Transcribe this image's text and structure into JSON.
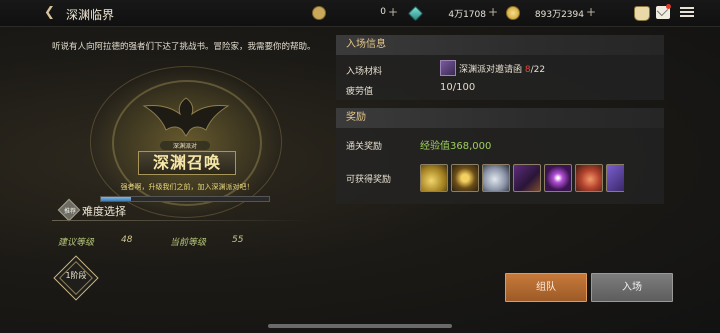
{
  "header": {
    "title": "深渊临界",
    "resources": [
      {
        "icon": "currency-icon",
        "value": "0"
      },
      {
        "icon": "gem-icon",
        "value": "4万1708"
      },
      {
        "icon": "gold-icon",
        "value": "893万2394"
      }
    ],
    "plus": "+"
  },
  "left": {
    "intro": "听说有人向阿拉德的强者们下达了挑战书。冒险家，我需要你的帮助。",
    "emblem": {
      "subtitle": "深渊派对",
      "title": "深渊召唤",
      "desc": "强者啊，升级我们之前，加入深渊派对吧！",
      "progress": 0.18
    },
    "difficulty": {
      "icon_text": "推荐",
      "label": "难度选择"
    },
    "levels": {
      "recommended_label": "建议等级",
      "recommended_value": "48",
      "current_label": "当前等级",
      "current_value": "55"
    },
    "stage_label": "1阶段"
  },
  "right": {
    "entry": {
      "header": "入场信息",
      "material_label": "入场材料",
      "material_name": "深渊派对邀请函",
      "material_count": "8",
      "material_total": "/22",
      "fatigue_label": "疲劳值",
      "fatigue_value": "10/100"
    },
    "rewards": {
      "header": "奖励",
      "clear_label": "通关奖励",
      "clear_value": "经验值368,000",
      "possible_label": "可获得奖励",
      "items": [
        "gold-coins-icon",
        "gold-orb-icon",
        "silver-ore-icon",
        "purple-box-icon",
        "purple-crystal-icon",
        "red-gem-icon",
        "purple-token-icon"
      ]
    }
  },
  "actions": {
    "team_label": "组队",
    "enter_label": "入场"
  },
  "colors": {
    "accent": "#e6c78a",
    "team_button": "#c77a3a",
    "enter_button": "#6d6d6d",
    "exp_green": "#9ccf5c",
    "count_red": "#e04a3a"
  }
}
